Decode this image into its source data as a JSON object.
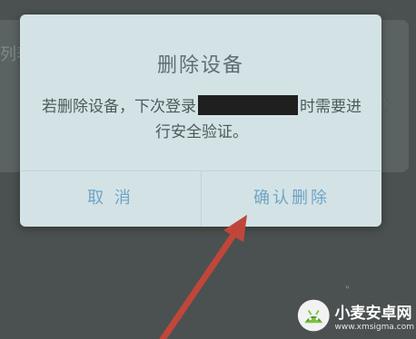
{
  "background": {
    "partial_text": "列表"
  },
  "dialog": {
    "title": "删除设备",
    "message_before": "若删除设备，下次登录",
    "message_after": "时需要进行安全验证。",
    "cancel_label": "取 消",
    "confirm_label": "确认删除"
  },
  "watermark": {
    "title": "小麦安卓网",
    "url": "www.xmsigma.com"
  },
  "colors": {
    "dialog_bg": "#d3e3e5",
    "button_text": "#6fa4c6",
    "arrow": "#c0463b",
    "overlay": "#4b5150"
  }
}
